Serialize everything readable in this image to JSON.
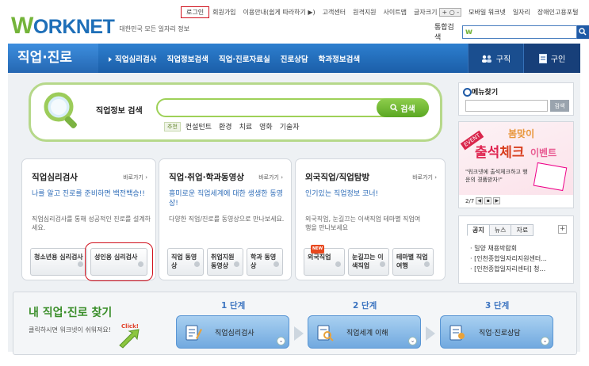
{
  "header": {
    "brand": "WORKNET",
    "brand_w": "W",
    "brand_rest": "ORKNET",
    "tagline": "대한민국 모든 일자리 정보",
    "util": {
      "login": "로그인",
      "join": "회원가입",
      "usage": "이용안내(쉽게 따라하기 ▶)",
      "customer": "고객센터",
      "remote": "원격지원",
      "sitemap": "사이트맵",
      "font_label": "글자크기",
      "font_ctrl": "+ ○ -",
      "mobile": "모바일 워크넷",
      "job": "일자리",
      "disabled": "장애인고용포털"
    },
    "search_label": "통합검색",
    "search_mini_logo": "w"
  },
  "nav": {
    "home": "직업·진로",
    "items": [
      "직업심리검사",
      "직업정보검색",
      "직업·진로자료실",
      "진로상담",
      "학과정보검색"
    ],
    "right": [
      "구직",
      "구인"
    ]
  },
  "big_search": {
    "label": "직업정보 검색",
    "button": "검색",
    "rec_tag": "추천",
    "keywords": [
      "컨설턴트",
      "환경",
      "치료",
      "영화",
      "기술자"
    ]
  },
  "cards": [
    {
      "title": "직업심리검사",
      "more": "바로가기",
      "highlight": "나를 알고 진로를 준비하면 백전백승!!",
      "desc": "직업심리검사를 통해 성공적인 진로를 설계하세요.",
      "buttons": [
        "청소년용 심리검사",
        "성인용 심리검사"
      ]
    },
    {
      "title": "직업·취업·학과동영상",
      "more": "바로가기",
      "highlight": "흥미로운 직업세계에 대한 생생한 동영상!",
      "desc": "다양한 직업/진로를 동영상으로 만나보세요.",
      "buttons": [
        "직업 동영상",
        "취업지원 동영상",
        "학과 동영상"
      ]
    },
    {
      "title": "외국직업/직업탐방",
      "more": "바로가기",
      "highlight": "인기있는 직업정보 코너!",
      "desc": "외국직업, 눈길끄는 이색직업 테마별 직업여행을 만나보세요",
      "buttons": [
        "외국직업",
        "눈길끄는 이색직업",
        "테마별 직업여행"
      ],
      "new_tag": "NEW"
    }
  ],
  "sidebar": {
    "menu_find": "메뉴찾기",
    "menu_find_btn": "검색",
    "event": {
      "tag": "EVENT",
      "line1": "봄맞이",
      "line2a": "출석",
      "line2b": "체크",
      "line3": "이벤트",
      "desc": "\"워크넷에 출석체크하고 행운의 경품받자!\"",
      "pager": "2/7"
    },
    "notice": {
      "tabs": [
        "공지",
        "뉴스",
        "자료"
      ],
      "plus": "+",
      "items": [
        "밀양 채용박람회",
        "[인천종합일자리지원센터...",
        "[인천종합일자리센터] 청..."
      ]
    }
  },
  "steps": {
    "title": "내 직업·진로 찾기",
    "sub": "클릭하시면 워크넷이 쉬워져요!",
    "click": "Click!",
    "items": [
      {
        "step": "1 단계",
        "label": "직업심리검사"
      },
      {
        "step": "2 단계",
        "label": "직업세계 이해"
      },
      {
        "step": "3 단계",
        "label": "직업·진로상담"
      }
    ]
  },
  "colors": {
    "nav_blue": "#1f5aa6",
    "accent_green": "#74b43a",
    "highlight_red": "#d0111d",
    "link_blue": "#2f6db8"
  }
}
